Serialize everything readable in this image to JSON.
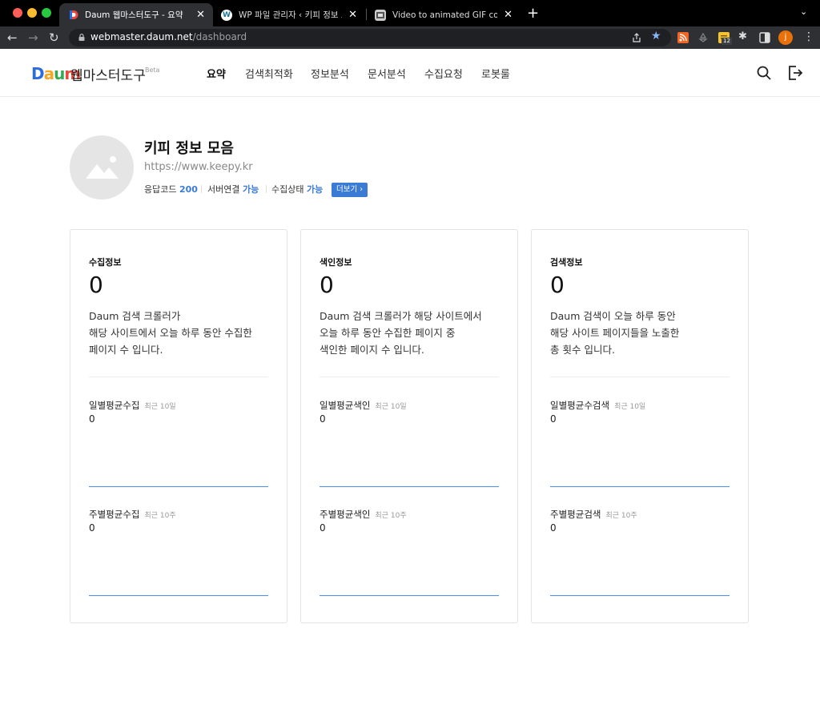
{
  "browser": {
    "tabs": [
      {
        "title": "Daum 웹마스터도구 - 요약",
        "active": true
      },
      {
        "title": "WP 파일 관리자 ‹ 키피 정보 모음 —",
        "active": false
      },
      {
        "title": "Video to animated GIF converte",
        "active": false
      }
    ],
    "url_host": "webmaster.daum.net",
    "url_path": "/dashboard",
    "extension_badge": "12",
    "profile_initial": "j"
  },
  "header": {
    "logo": [
      "D",
      "a",
      "u",
      "m"
    ],
    "logo_colors": [
      "#2b6de1",
      "#f6a623",
      "#34a853",
      "#e54a3c"
    ],
    "brand": "웹마스터도구",
    "beta": "Beta",
    "nav": [
      "요약",
      "검색최적화",
      "정보분석",
      "문서분석",
      "수집요청",
      "로봇룰"
    ]
  },
  "site": {
    "name": "키피 정보 모음",
    "url": "https://www.keepy.kr",
    "stats": [
      {
        "label": "응답코드",
        "value": "200"
      },
      {
        "label": "서버연결",
        "value": "가능"
      },
      {
        "label": "수집상태",
        "value": "가능"
      }
    ],
    "more_label": "더보기"
  },
  "cards": [
    {
      "title": "수집정보",
      "value": "0",
      "desc": [
        "Daum 검색 크롤러가",
        "해당 사이트에서 오늘 하루 동안 수집한",
        "페이지 수 입니다."
      ],
      "daily_label": "일별평균수집",
      "daily_hint": "최근 10일",
      "daily_value": "0",
      "weekly_label": "주별평균수집",
      "weekly_hint": "최근 10주",
      "weekly_value": "0"
    },
    {
      "title": "색인정보",
      "value": "0",
      "desc": [
        "Daum 검색 크롤러가 해당 사이트에서",
        "오늘 하루 동안 수집한 페이지 중",
        "색인한 페이지 수 입니다."
      ],
      "daily_label": "일별평균색인",
      "daily_hint": "최근 10일",
      "daily_value": "0",
      "weekly_label": "주별평균색인",
      "weekly_hint": "최근 10주",
      "weekly_value": "0"
    },
    {
      "title": "검색정보",
      "value": "0",
      "desc": [
        "Daum 검색이 오늘 하루 동안",
        "해당 사이트 페이지들을 노출한",
        "총 횟수 입니다."
      ],
      "daily_label": "일별평균수검색",
      "daily_hint": "최근 10일",
      "daily_value": "0",
      "weekly_label": "주별평균검색",
      "weekly_hint": "최근 10주",
      "weekly_value": "0"
    }
  ]
}
